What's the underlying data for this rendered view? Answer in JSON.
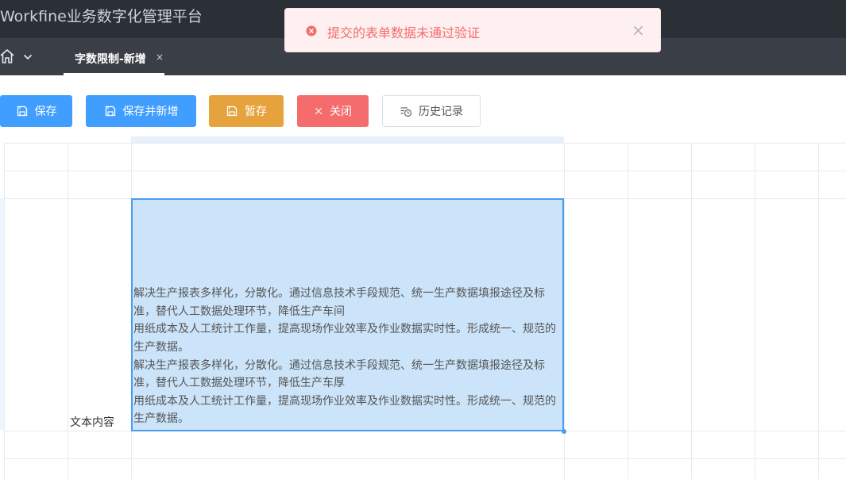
{
  "app": {
    "title": "Workfine业务数字化管理平台"
  },
  "tabs": [
    {
      "label": "字数限制-新增",
      "close": "×"
    }
  ],
  "toolbar": {
    "save_label": "保存",
    "save_new_label": "保存并新增",
    "draft_label": "暂存",
    "close_label": "关闭",
    "history_label": "历史记录"
  },
  "form": {
    "field_label": "文本内容",
    "field_value": "解决生产报表多样化，分散化。通过信息技术手段规范、统一生产数据填报途径及标准，替代人工数据处理环节，降低生产车间\n用纸成本及人工统计工作量，提高现场作业效率及作业数据实时性。形成统一、规范的生产数据。\n解决生产报表多样化，分散化。通过信息技术手段规范、统一生产数据填报途径及标准，替代人工数据处理环节，降低生产车厚\n用纸成本及人工统计工作量，提高现场作业效率及作业数据实时性。形成统一、规范的生产数据。"
  },
  "toast": {
    "message": "提交的表单数据未通过验证",
    "close": "×",
    "type": "error"
  },
  "icons": {
    "home": "home-icon",
    "chevron": "chevron-down-icon",
    "save": "save-icon",
    "close": "close-icon",
    "history": "history-icon",
    "error": "error-circle-icon"
  },
  "colors": {
    "primary": "#409eff",
    "warning": "#e6a23c",
    "danger": "#f56c6c",
    "header": "#2b2f36",
    "tabbar": "#3a3f47",
    "selection": "#cce4f9"
  }
}
